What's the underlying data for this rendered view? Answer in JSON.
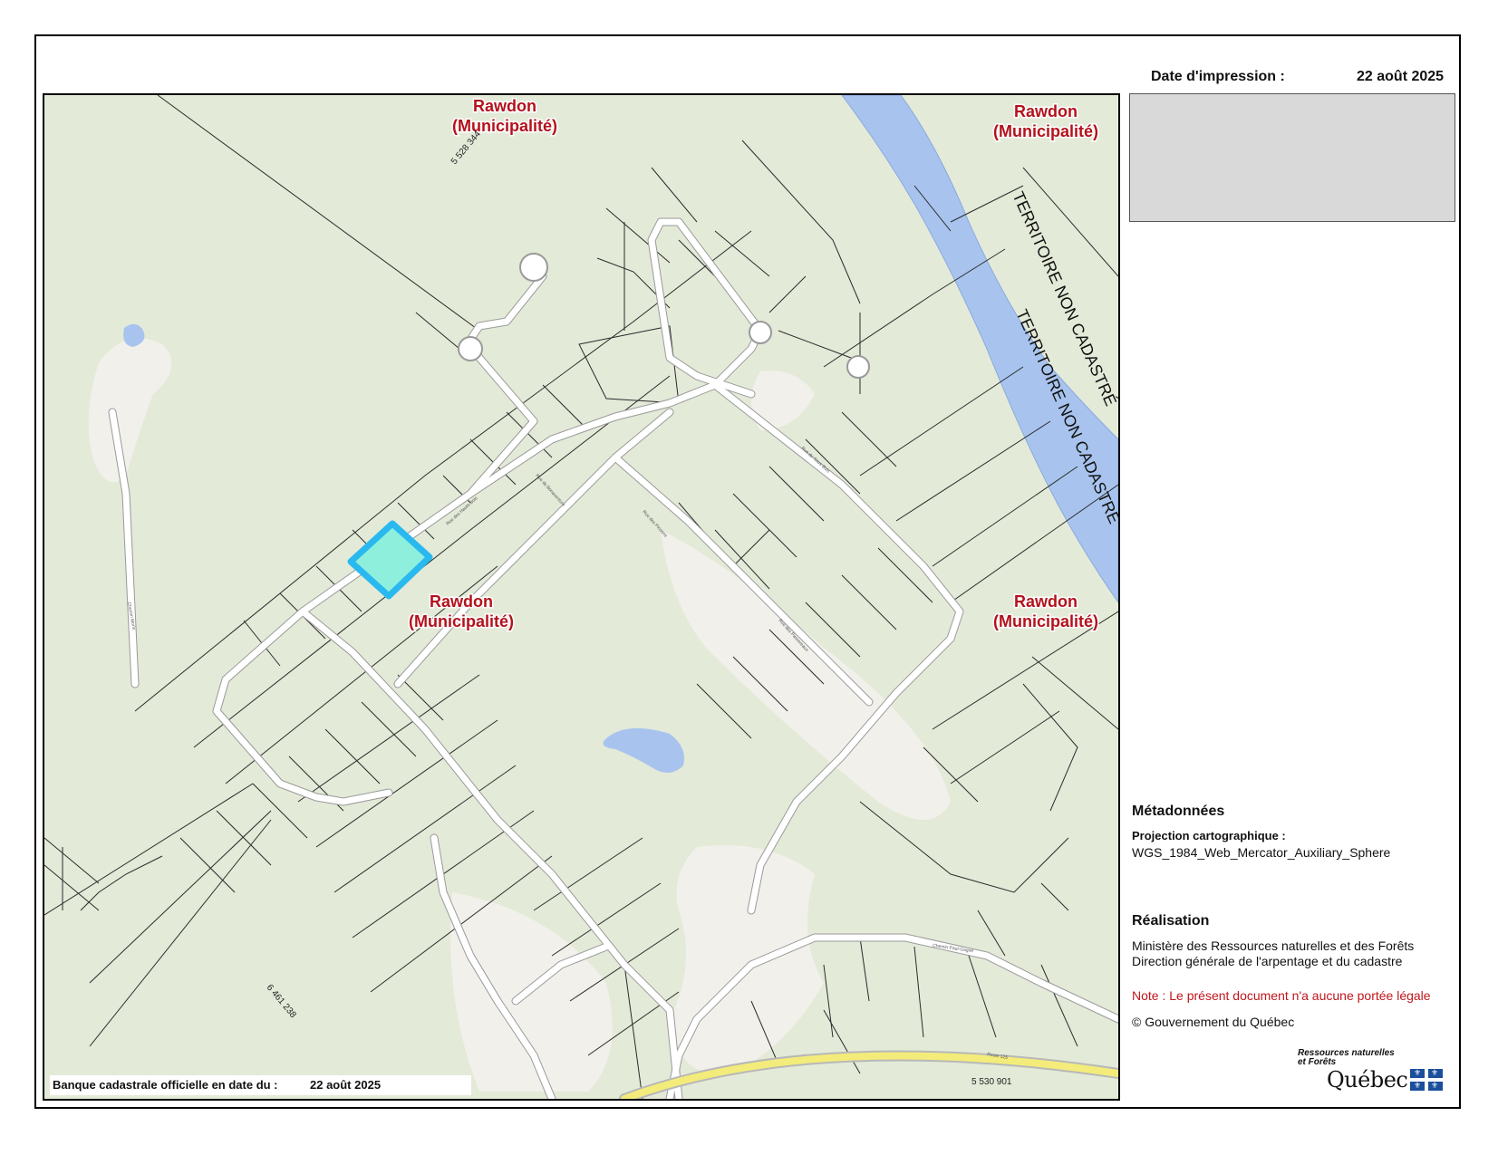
{
  "header": {
    "print_date_label": "Date d'impression :",
    "print_date_value": "22 août 2025"
  },
  "map": {
    "municipalities": [
      {
        "line1": "Rawdon",
        "line2": "(Municipalité)"
      },
      {
        "line1": "Rawdon",
        "line2": "(Municipalité)"
      },
      {
        "line1": "Rawdon",
        "line2": "(Municipalité)"
      },
      {
        "line1": "Rawdon",
        "line2": "(Municipalité)"
      }
    ],
    "territories": [
      "TERRITOIRE NON CADASTRÉ",
      "TERRITOIRE NON CADASTRÉ"
    ],
    "lot_numbers": [
      "5 528 344",
      "6 461 238",
      "5 530 901"
    ],
    "street_labels": [
      "Rue des Hauts-Bois",
      "Rue de Bonaventure",
      "Rue des Pinsons",
      "Rue du Sous-Bois",
      "Rue des Passereaux",
      "Chemin Paul-Gagné",
      "Route 125",
      "Chemin Morin"
    ],
    "colors": {
      "background": "#e3ead8",
      "river": "#a8c4ee",
      "selected_lot_fill": "#8ef0dc",
      "selected_lot_outline": "#2ab9ef",
      "road": "#ffffff",
      "highway": "#f3ec7a",
      "clearing": "#f2f0ea",
      "municipality_label": "#b3121c"
    }
  },
  "cadastre_bar": {
    "label": "Banque cadastrale officielle en date du :",
    "value": "22 août 2025"
  },
  "metadata": {
    "title": "Métadonnées",
    "projection_label": "Projection cartographique :",
    "projection_value": "WGS_1984_Web_Mercator_Auxiliary_Sphere",
    "realisation_title": "Réalisation",
    "realisation_line1": "Ministère des Ressources naturelles et des Forêts",
    "realisation_line2": "Direction générale de l'arpentage et du cadastre",
    "note": "Note : Le présent document n'a aucune portée légale",
    "copyright": "© Gouvernement du Québec"
  },
  "logo": {
    "line1": "Ressources naturelles",
    "line2": "et Forêts",
    "word": "Québec"
  }
}
